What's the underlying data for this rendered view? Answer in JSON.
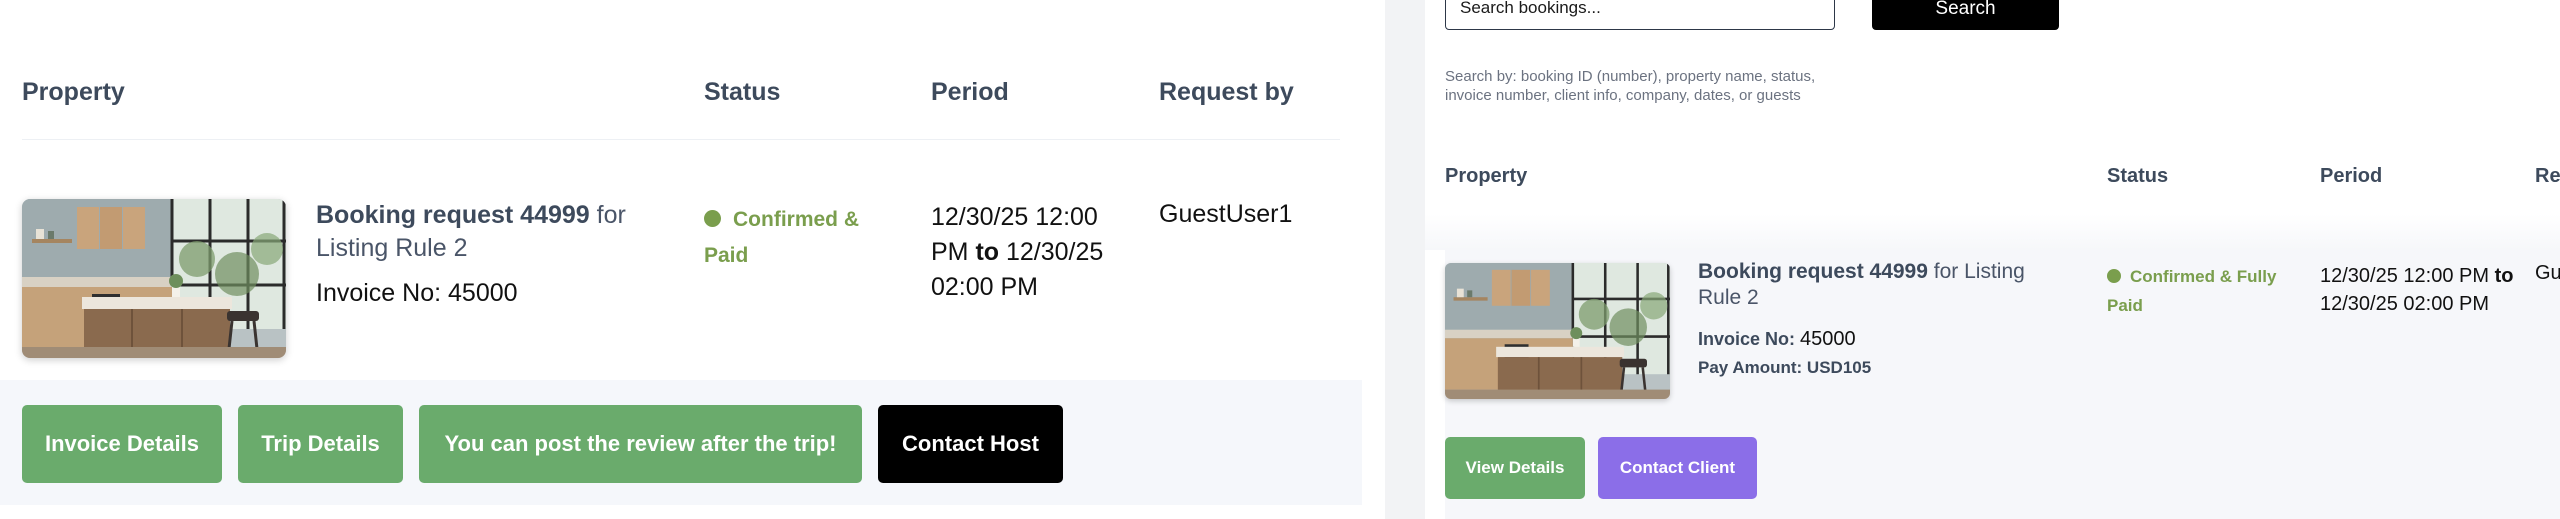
{
  "left_panel": {
    "columns": [
      "Property",
      "Status",
      "Period",
      "Request by"
    ],
    "booking": {
      "title_bold": "Booking request 44999",
      "title_rest": " for Listing Rule 2",
      "invoice": "Invoice No: 45000",
      "status": "Confirmed & Paid",
      "period_start": "12/30/25 12:00 PM",
      "period_sep": " to ",
      "period_end": "12/30/25 02:00 PM",
      "requested_by": "GuestUser1"
    },
    "actions": {
      "invoice_details": "Invoice Details",
      "trip_details": "Trip Details",
      "review_notice": "You can post the review after the trip!",
      "contact_host": "Contact Host"
    }
  },
  "right_panel": {
    "search": {
      "placeholder": "Search bookings...",
      "button": "Search",
      "help": "Search by: booking ID (number), property name, status, invoice number, client info, company, dates, or guests"
    },
    "columns": [
      "Property",
      "Status",
      "Period",
      "Requ"
    ],
    "booking": {
      "title_bold": "Booking request 44999",
      "title_rest": " for Listing Rule 2",
      "invoice_label": "Invoice No: ",
      "invoice_value": "45000",
      "pay_amount": "Pay Amount: USD105",
      "status": "Confirmed & Fully Paid",
      "period_start": "12/30/25 12:00 PM",
      "period_sep": " to ",
      "period_end": "12/30/25 02:00 PM",
      "requested_by": "Gues"
    },
    "actions": {
      "view_details": "View Details",
      "contact_client": "Contact Client"
    }
  },
  "colors": {
    "status_green": "#7a9e4d",
    "button_green": "#6aab6c",
    "button_purple": "#8b6ee8",
    "button_black": "#000000"
  }
}
